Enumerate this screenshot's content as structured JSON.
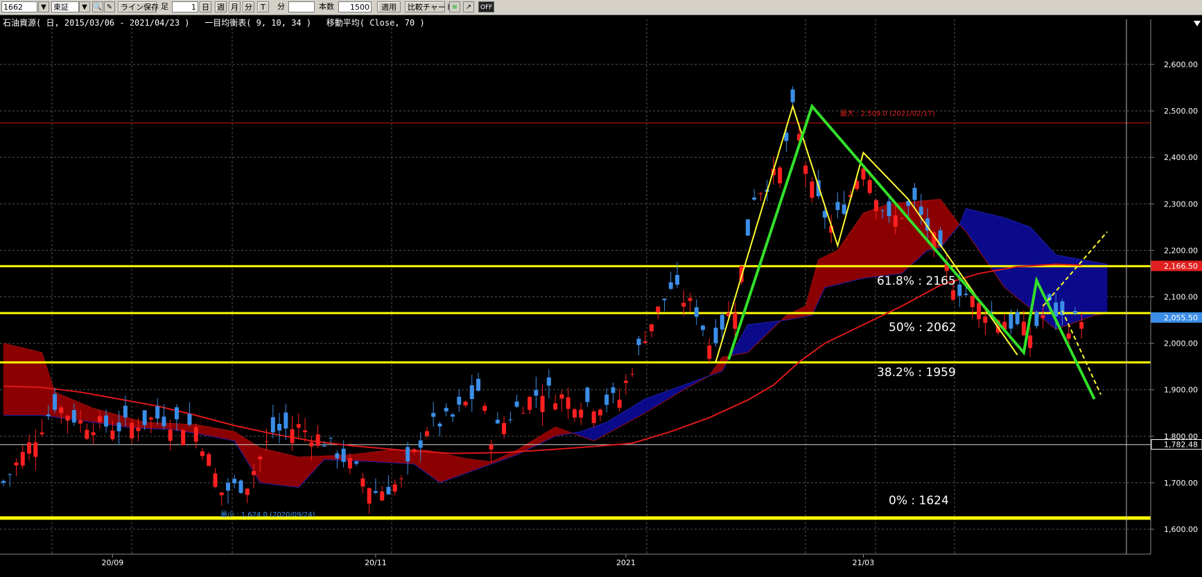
{
  "toolbar": {
    "code": "1662",
    "market": "東証",
    "line_save": "ライン保存",
    "ashi_label": "足",
    "ashi_value": "1",
    "btn_day": "日",
    "btn_week": "週",
    "btn_month": "月",
    "btn_minute": "分",
    "btn_tick": "T",
    "minute_label": "分",
    "honsu_label": "本数",
    "honsu_value": "1500",
    "apply": "適用",
    "compare": "比較チャート",
    "off": "OFF"
  },
  "info_line": "石油資源( 日, 2015/03/06 - 2021/04/23 )   一目均衡表( 9, 10, 34 )   移動平均( Close, 70 )",
  "colors": {
    "up": "#ff2020",
    "down": "#3b8ee8",
    "cloud_up": "#8b0000",
    "cloud_down": "#0a0a8a",
    "ma": "#e01818",
    "fib": "#ffff00",
    "wave_green": "#33e02a",
    "wave_yellow": "#ffff30"
  },
  "chart_data": {
    "type": "candlestick",
    "ylim": [
      1560,
      2680
    ],
    "y_ticks": [
      "2,600.00",
      "2,500.00",
      "2,400.00",
      "2,300.00",
      "2,200.00",
      "2,100.00",
      "2,000.00",
      "1,900.00",
      "1,800.00",
      "1,700.00",
      "1,600.00"
    ],
    "y_tick_values": [
      2600,
      2500,
      2400,
      2300,
      2200,
      2100,
      2000,
      1900,
      1800,
      1700,
      1600
    ],
    "x_labels": [
      {
        "label": "20/09",
        "index": 17
      },
      {
        "label": "20/11",
        "index": 58
      },
      {
        "label": "2021",
        "index": 97
      },
      {
        "label": "21/03",
        "index": 134
      }
    ],
    "n_slots": 176,
    "fib_levels": [
      {
        "label": "61.8% : 2165",
        "value": 2166
      },
      {
        "label": "50% : 2062",
        "value": 2065
      },
      {
        "label": "38.2% : 1959",
        "value": 1959
      },
      {
        "label": "0% : 1624",
        "value": 1624
      }
    ],
    "price_badges": [
      {
        "label": "2,166.50",
        "value": 2166.5,
        "bg": "#e02020"
      },
      {
        "label": "2,055.50",
        "value": 2055.5,
        "bg": "#3b8ee8"
      },
      {
        "label": "1,782.48",
        "value": 1782.48,
        "bg": "#000000"
      }
    ],
    "max_label": "最大 : 2,509.0 (2021/02/17)",
    "min_label": "最小 : 1,624.0 (2020/09/24)",
    "max_hline": 2474,
    "white_hline": 1782,
    "green_wave": [
      [
        113,
        1965
      ],
      [
        126,
        2510
      ],
      [
        159,
        1980
      ],
      [
        161,
        2135
      ],
      [
        170,
        1880
      ]
    ],
    "yellow_wave": [
      [
        111,
        1960
      ],
      [
        123,
        2510
      ],
      [
        130,
        2210
      ],
      [
        134,
        2410
      ],
      [
        141,
        2310
      ],
      [
        158,
        1975
      ]
    ],
    "yellow_dash": [
      [
        162,
        2080
      ],
      [
        172,
        2240
      ]
    ],
    "yellow_dash2": [
      [
        165,
        2070
      ],
      [
        171,
        1890
      ]
    ],
    "ma70": [
      [
        0,
        1908
      ],
      [
        6,
        1905
      ],
      [
        12,
        1895
      ],
      [
        18,
        1880
      ],
      [
        24,
        1865
      ],
      [
        30,
        1845
      ],
      [
        36,
        1823
      ],
      [
        42,
        1805
      ],
      [
        48,
        1790
      ],
      [
        54,
        1780
      ],
      [
        62,
        1770
      ],
      [
        70,
        1763
      ],
      [
        78,
        1765
      ],
      [
        86,
        1772
      ],
      [
        92,
        1778
      ],
      [
        98,
        1785
      ],
      [
        104,
        1810
      ],
      [
        110,
        1840
      ],
      [
        116,
        1878
      ],
      [
        120,
        1910
      ],
      [
        124,
        1960
      ],
      [
        128,
        2000
      ],
      [
        134,
        2040
      ],
      [
        140,
        2080
      ],
      [
        146,
        2125
      ],
      [
        152,
        2150
      ],
      [
        158,
        2165
      ],
      [
        164,
        2170
      ],
      [
        168,
        2168
      ]
    ],
    "cloud_a": [
      [
        0,
        2000
      ],
      [
        6,
        1980
      ],
      [
        8,
        1895
      ],
      [
        14,
        1860
      ],
      [
        22,
        1830
      ],
      [
        30,
        1825
      ],
      [
        36,
        1810
      ],
      [
        40,
        1775
      ],
      [
        46,
        1755
      ],
      [
        54,
        1760
      ],
      [
        60,
        1770
      ],
      [
        66,
        1770
      ],
      [
        72,
        1752
      ],
      [
        76,
        1745
      ],
      [
        80,
        1770
      ],
      [
        86,
        1820
      ],
      [
        90,
        1800
      ],
      [
        92,
        1790
      ],
      [
        96,
        1820
      ],
      [
        100,
        1850
      ],
      [
        106,
        1900
      ],
      [
        110,
        1930
      ],
      [
        112,
        1970
      ],
      [
        116,
        1980
      ],
      [
        122,
        2060
      ],
      [
        125,
        2080
      ],
      [
        127,
        2180
      ],
      [
        130,
        2200
      ],
      [
        134,
        2280
      ],
      [
        138,
        2300
      ],
      [
        142,
        2305
      ],
      [
        146,
        2310
      ],
      [
        149,
        2255
      ],
      [
        150,
        2240
      ],
      [
        156,
        2120
      ],
      [
        164,
        2030
      ],
      [
        170,
        2060
      ],
      [
        172,
        2065
      ]
    ],
    "cloud_b": [
      [
        0,
        1845
      ],
      [
        6,
        1845
      ],
      [
        14,
        1830
      ],
      [
        20,
        1818
      ],
      [
        26,
        1815
      ],
      [
        30,
        1806
      ],
      [
        36,
        1790
      ],
      [
        40,
        1700
      ],
      [
        46,
        1690
      ],
      [
        50,
        1750
      ],
      [
        58,
        1745
      ],
      [
        64,
        1740
      ],
      [
        68,
        1700
      ],
      [
        72,
        1720
      ],
      [
        80,
        1760
      ],
      [
        86,
        1800
      ],
      [
        90,
        1810
      ],
      [
        94,
        1830
      ],
      [
        100,
        1880
      ],
      [
        104,
        1900
      ],
      [
        108,
        1920
      ],
      [
        112,
        1940
      ],
      [
        116,
        2040
      ],
      [
        122,
        2050
      ],
      [
        126,
        2060
      ],
      [
        128,
        2120
      ],
      [
        134,
        2140
      ],
      [
        140,
        2150
      ],
      [
        144,
        2200
      ],
      [
        146,
        2205
      ],
      [
        149,
        2255
      ],
      [
        150,
        2290
      ],
      [
        156,
        2270
      ],
      [
        160,
        2250
      ],
      [
        164,
        2190
      ],
      [
        170,
        2175
      ],
      [
        172,
        2170
      ]
    ]
  }
}
